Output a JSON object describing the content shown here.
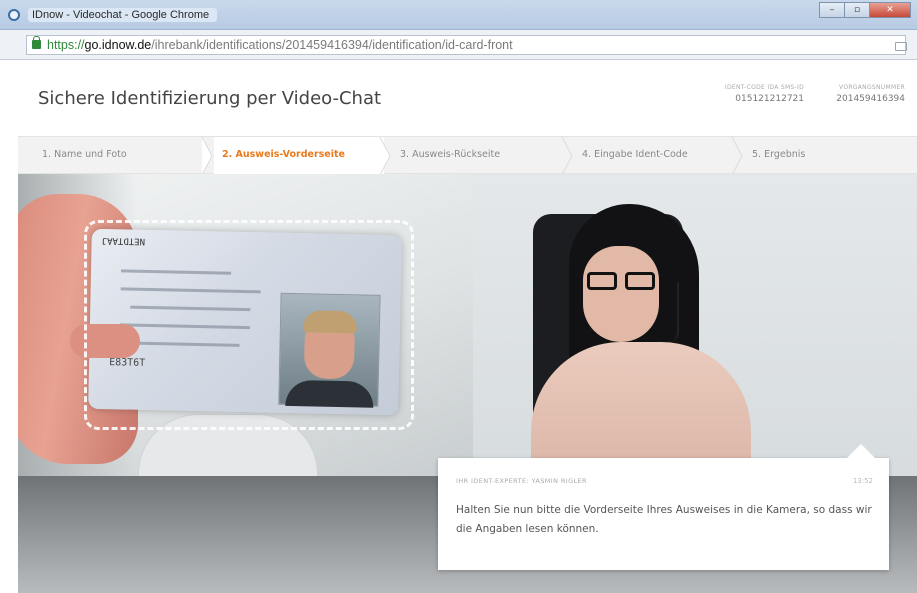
{
  "browser": {
    "tab_title": "IDnow - Videochat - Google Chrome",
    "url_scheme": "https://",
    "url_host": "go.idnow.de",
    "url_path": "/ihrebank/identifications/20145941639​4/identification/id-card-front"
  },
  "header": {
    "title": "Sichere Identifizierung per Video-Chat",
    "ident_code_label": "IDENT-CODE IDA SMS-ID",
    "ident_code_value": "015121212721",
    "transaction_label": "VORGANGSNUMMER",
    "transaction_value": "201459416394"
  },
  "steps": [
    {
      "label": "1. Name und Foto",
      "active": false
    },
    {
      "label": "2. Ausweis-Vorderseite",
      "active": true
    },
    {
      "label": "3. Ausweis-Rückseite",
      "active": false
    },
    {
      "label": "4. Eingabe Ident-Code",
      "active": false
    },
    {
      "label": "5. Ergebnis",
      "active": false
    }
  ],
  "id_card": {
    "code": "E83T6T",
    "head": "NETDTAAJ"
  },
  "chat": {
    "label": "IHR IDENT-EXPERTE: YASMIN RIGLER",
    "time": "13:52",
    "message": "Halten Sie nun bitte die Vorderseite Ihres Ausweises in die Kamera, so dass wir die Angaben lesen können."
  },
  "colors": {
    "accent": "#e87a1e",
    "secure_green": "#2f8a3a"
  }
}
